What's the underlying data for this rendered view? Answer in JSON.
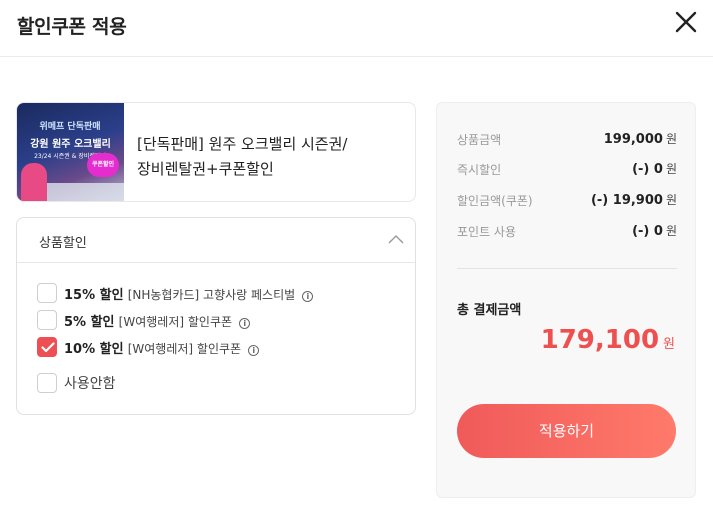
{
  "header": {
    "title": "할인쿠폰 적용"
  },
  "product": {
    "name": "[단독판매] 원주 오크밸리 시즌권/장비렌탈권+쿠폰할인",
    "thumb_line1": "위메프 단독판매",
    "thumb_line2": "강원 원주 오크밸리",
    "thumb_line3": "23/24 시즌권 & 장비렌탈권",
    "thumb_badge": "쿠폰할인"
  },
  "discount": {
    "title": "상품할인",
    "options": [
      {
        "pct": "15% 할인",
        "desc": "[NH농협카드] 고향사랑 페스티벌",
        "checked": false
      },
      {
        "pct": "5% 할인",
        "desc": "[W여행레저] 할인쿠폰",
        "checked": false
      },
      {
        "pct": "10% 할인",
        "desc": "[W여행레저] 할인쿠폰",
        "checked": true
      }
    ],
    "none_label": "사용안함",
    "info_glyph": "i"
  },
  "summary": {
    "rows": [
      {
        "label": "상품금액",
        "value": "199,000",
        "unit": "원"
      },
      {
        "label": "즉시할인",
        "value": "(-) 0",
        "unit": "원"
      },
      {
        "label": "할인금액(쿠폰)",
        "value": "(-) 19,900",
        "unit": "원"
      },
      {
        "label": "포인트 사용",
        "value": "(-) 0",
        "unit": "원"
      }
    ],
    "total_label": "총 결제금액",
    "total_value": "179,100",
    "total_unit": "원",
    "apply_label": "적용하기"
  },
  "colors": {
    "accent": "#ee4f54",
    "button_start": "#f05a5a",
    "button_end": "#ff7a6a"
  }
}
